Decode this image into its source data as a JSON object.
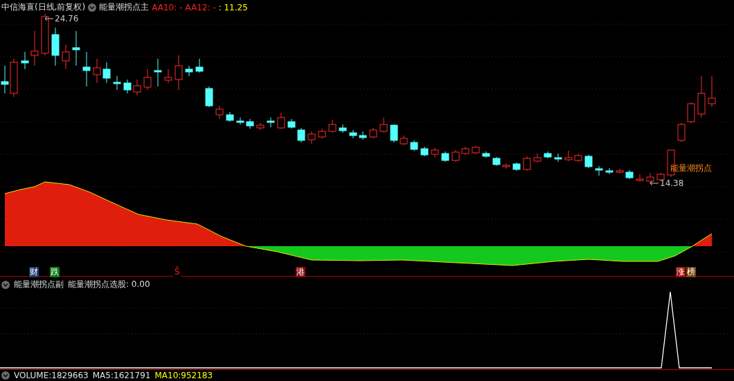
{
  "main_panel": {
    "security": "中信海直(日线,前复权)",
    "indicator": "能量潮拐点主",
    "values": [
      {
        "text": "AA10: -",
        "color": "#ff2020"
      },
      {
        "text": "AA12: -",
        "color": "#ff2020"
      },
      {
        "text": ": 11.25",
        "color": "#ffff00"
      }
    ],
    "price_labels": [
      {
        "text": "24.76",
        "kind": "high"
      },
      {
        "text": "14.38",
        "kind": "low"
      }
    ],
    "signal_label": "能量潮拐点",
    "markers": [
      {
        "text": "财",
        "color": "#1c3c6c"
      },
      {
        "text": "跌",
        "color": "#0a7a10"
      },
      {
        "text": "Ŝ",
        "color": "#000000"
      },
      {
        "text": "港",
        "color": "#8a0a0a"
      },
      {
        "text": "涨",
        "color": "#9a0c0c"
      },
      {
        "text": "榜",
        "color": "#7a4008"
      }
    ]
  },
  "sub_panel": {
    "indicator": "能量潮拐点副",
    "value": "能量潮拐点选股: 0.00"
  },
  "status_bar": {
    "values": [
      {
        "text": "VOLUME:1829663",
        "color": "#e0e0e0"
      },
      {
        "text": "MA5:1621791",
        "color": "#e0e0e0"
      },
      {
        "text": "MA10:952183",
        "color": "#ffff00"
      }
    ]
  }
}
